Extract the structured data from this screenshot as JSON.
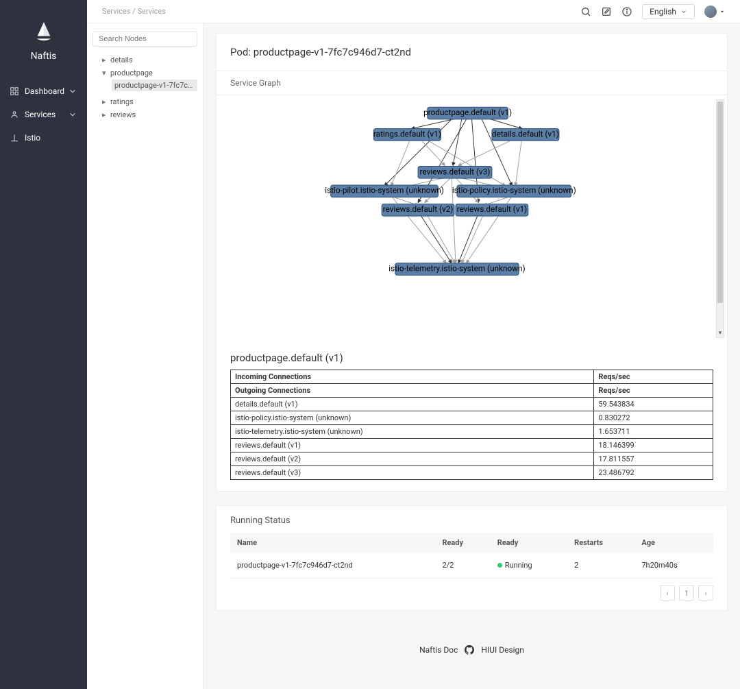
{
  "brand": "Naftis",
  "nav": {
    "dashboard": "Dashboard",
    "services": "Services",
    "istio": "Istio"
  },
  "breadcrumb": "Services / Services",
  "lang": "English",
  "search_placeholder": "Search Nodes",
  "tree": {
    "details": "details",
    "productpage": "productpage",
    "productpage_pod": "productpage-v1-7fc7c946...",
    "ratings": "ratings",
    "reviews": "reviews"
  },
  "pod_title": "Pod: productpage-v1-7fc7c946d7-ct2nd",
  "graph_title": "Service Graph",
  "graph_nodes": {
    "productpage": "productpage.default (v1)",
    "ratings": "ratings.default (v1)",
    "details": "details.default (v1)",
    "reviews_v3": "reviews.default (v3)",
    "pilot": "istio-pilot.istio-system (unknown)",
    "policy": "istio-policy.istio-system (unknown)",
    "reviews_v2": "reviews.default (v2)",
    "reviews_v1": "reviews.default (v1)",
    "telemetry": "istio-telemetry.istio-system (unknown)"
  },
  "conn_section_title": "productpage.default (v1)",
  "conn_headers": {
    "incoming": "Incoming Connections",
    "outgoing": "Outgoing Connections",
    "reqs": "Reqs/sec"
  },
  "connections": [
    {
      "name": "details.default (v1)",
      "reqs": "59.543834"
    },
    {
      "name": "istio-policy.istio-system (unknown)",
      "reqs": "0.830272"
    },
    {
      "name": "istio-telemetry.istio-system (unknown)",
      "reqs": "1.653711"
    },
    {
      "name": "reviews.default (v1)",
      "reqs": "18.146399"
    },
    {
      "name": "reviews.default (v2)",
      "reqs": "17.811557"
    },
    {
      "name": "reviews.default (v3)",
      "reqs": "23.486792"
    }
  ],
  "status_title": "Running Status",
  "status_headers": {
    "name": "Name",
    "ready": "Ready",
    "ready2": "Ready",
    "restarts": "Restarts",
    "age": "Age"
  },
  "status_row": {
    "name": "productpage-v1-7fc7c946d7-ct2nd",
    "ready": "2/2",
    "state": "Running",
    "restarts": "2",
    "age": "7h20m40s"
  },
  "pager": {
    "page": "1"
  },
  "footer": {
    "doc": "Naftis Doc",
    "design": "HIUI Design"
  }
}
